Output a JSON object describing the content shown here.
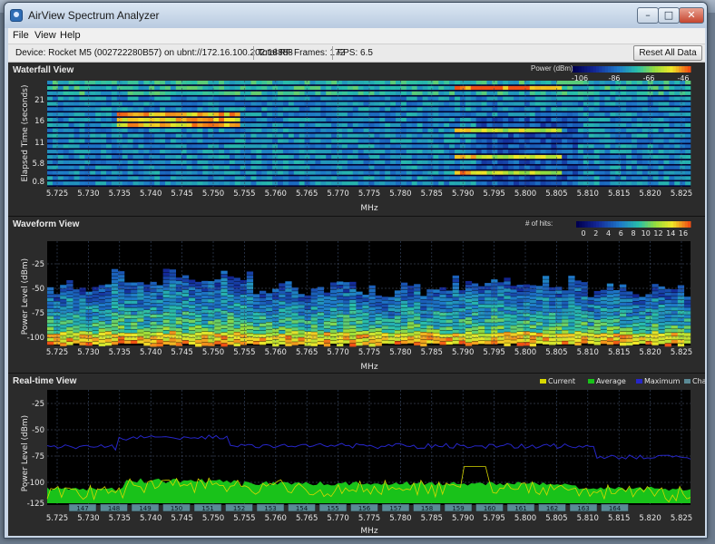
{
  "window": {
    "title": "AirView Spectrum Analyzer"
  },
  "menu": [
    "File",
    "View",
    "Help"
  ],
  "info": {
    "device": "Device: Rocket M5 (002722280B57) on ubnt://172.16.100.202:18888",
    "frames": "Total RF Frames: 172",
    "fps": "FPS: 6.5",
    "reset_label": "Reset All Data"
  },
  "x_axis": {
    "label": "MHz",
    "ticks": [
      "5.725",
      "5.730",
      "5.735",
      "5.740",
      "5.745",
      "5.750",
      "5.755",
      "5.760",
      "5.765",
      "5.770",
      "5.775",
      "5.780",
      "5.785",
      "5.790",
      "5.795",
      "5.800",
      "5.805",
      "5.810",
      "5.815",
      "5.820",
      "5.825"
    ]
  },
  "waterfall": {
    "title": "Waterfall View",
    "ylabel": "Elapsed Time (seconds)",
    "yticks": [
      "21",
      "16",
      "11",
      "5.8",
      "0.8"
    ],
    "legend_title": "Power (dBm):",
    "legend_ticks": [
      "-106",
      "-86",
      "-66",
      "-46"
    ]
  },
  "waveform": {
    "title": "Waveform View",
    "ylabel": "Power Level (dBm)",
    "yticks": [
      "-25",
      "-50",
      "-75",
      "-100"
    ],
    "legend_title": "# of hits:",
    "legend_ticks": [
      "0",
      "2",
      "4",
      "6",
      "8",
      "10",
      "12",
      "14",
      "16"
    ]
  },
  "realtime": {
    "title": "Real-time View",
    "ylabel": "Power Level (dBm)",
    "yticks": [
      "-25",
      "-50",
      "-75",
      "-100",
      "-125"
    ],
    "legend": [
      {
        "name": "Current",
        "color": "#d8d800"
      },
      {
        "name": "Average",
        "color": "#19c21a"
      },
      {
        "name": "Maximum",
        "color": "#2626c8"
      },
      {
        "name": "Channels",
        "color": "#5a8a96"
      }
    ],
    "channels": [
      "147",
      "148",
      "149",
      "150",
      "151",
      "152",
      "153",
      "154",
      "155",
      "156",
      "157",
      "158",
      "159",
      "160",
      "161",
      "162",
      "163",
      "164"
    ]
  },
  "colors": {
    "panel_bg": "#2b2b2b",
    "plot_bg": "#000000",
    "current": "#d8d800",
    "average": "#19c21a",
    "maximum": "#2626c8"
  }
}
